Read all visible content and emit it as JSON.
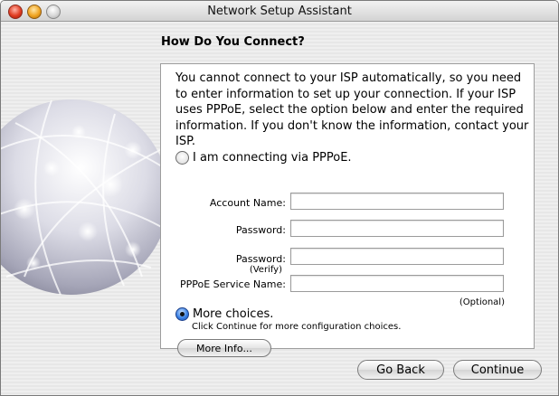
{
  "window": {
    "title": "Network Setup Assistant"
  },
  "page": {
    "heading": "How Do You Connect?",
    "description": "You cannot connect to your ISP automatically, so you need to enter information to set up your connection. If your ISP uses PPPoE, select the option below and enter the required information. If you don't know the information, contact your ISP."
  },
  "options": {
    "pppoe": {
      "label": "I am connecting via PPPoE.",
      "selected": false
    },
    "more_choices": {
      "label": "More choices.",
      "selected": true,
      "hint": "Click Continue for more configuration choices."
    }
  },
  "fields": {
    "account_name": {
      "label": "Account Name:",
      "value": ""
    },
    "password": {
      "label": "Password:",
      "value": ""
    },
    "password_verify": {
      "label": "Password:",
      "sublabel": "(Verify)",
      "value": ""
    },
    "service_name": {
      "label": "PPPoE Service Name:",
      "value": "",
      "note": "(Optional)"
    }
  },
  "buttons": {
    "more_info": "More Info...",
    "go_back": "Go Back",
    "continue": "Continue"
  },
  "icons": {
    "window_close": "close-icon",
    "window_minimize": "minimize-icon",
    "window_zoom": "zoom-icon",
    "illustration": "network-globe-icon"
  }
}
